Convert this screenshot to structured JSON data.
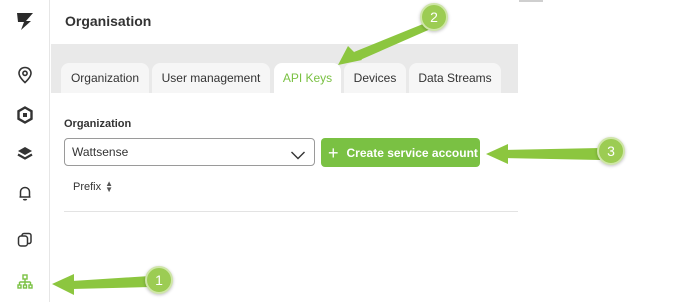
{
  "app": {
    "page_title": "Organisation"
  },
  "sidebar": {
    "icons": [
      "logo-icon",
      "location-pin-icon",
      "hexagon-devices-icon",
      "layers-icon",
      "bell-icon",
      "copy-icon",
      "org-tree-icon"
    ]
  },
  "tabs": [
    {
      "label": "Organization",
      "active": false
    },
    {
      "label": "User management",
      "active": false
    },
    {
      "label": "API Keys",
      "active": true
    },
    {
      "label": "Devices",
      "active": false
    },
    {
      "label": "Data Streams",
      "active": false
    }
  ],
  "main": {
    "organization_label": "Organization",
    "organization_value": "Wattsense",
    "create_button_label": "Create service account",
    "create_button_icon": "+",
    "table_columns": [
      {
        "label": "Prefix",
        "sortable": true
      }
    ]
  },
  "annotations": {
    "callouts": [
      "1",
      "2",
      "3"
    ],
    "color": "#9ccc53"
  },
  "colors": {
    "accent": "#7ac143"
  }
}
